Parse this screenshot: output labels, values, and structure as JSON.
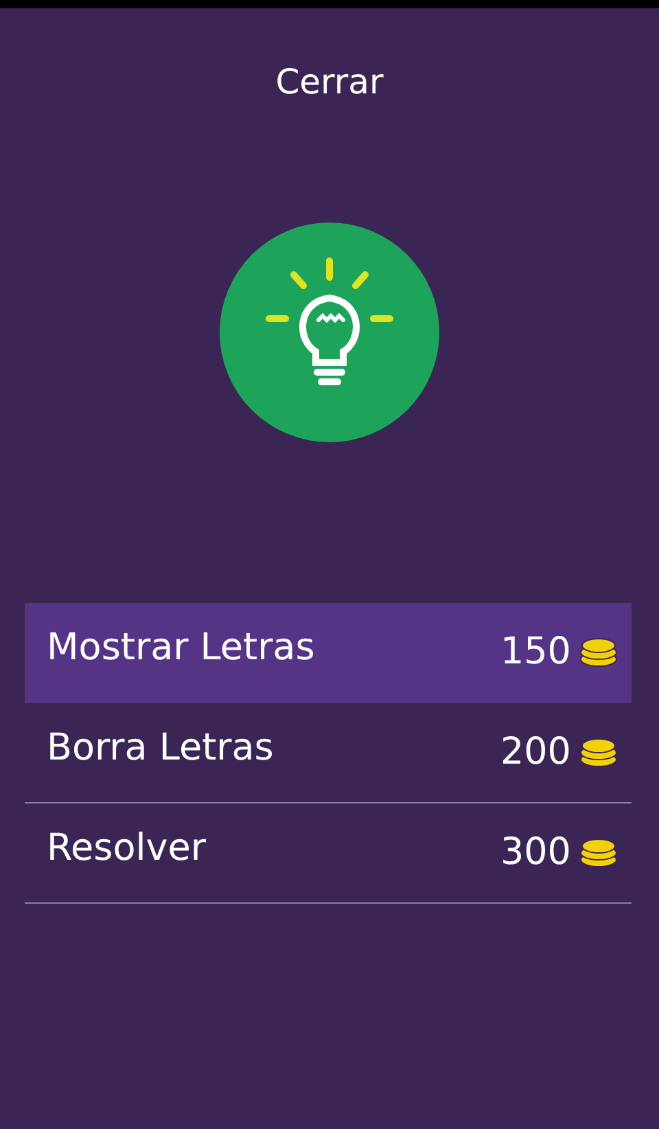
{
  "close_button": "Cerrar",
  "options": [
    {
      "label": "Mostrar Letras",
      "price": "150",
      "selected": true
    },
    {
      "label": "Borra Letras",
      "price": "200",
      "selected": false
    },
    {
      "label": "Resolver",
      "price": "300",
      "selected": false
    }
  ]
}
